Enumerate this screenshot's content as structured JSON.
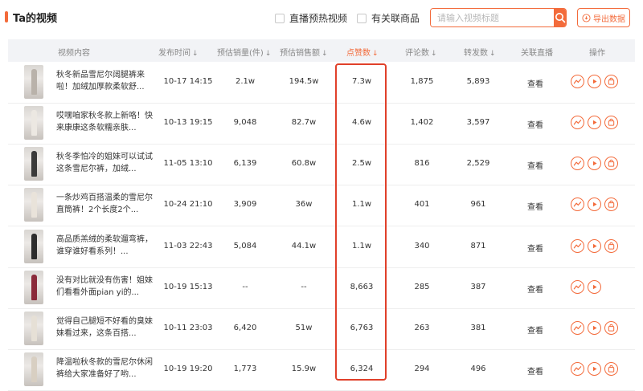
{
  "header": {
    "title": "Ta的视频",
    "checkbox_live_preheat": "直播预热视频",
    "checkbox_linked_product": "有关联商品",
    "search_placeholder": "请输入视频标题",
    "export_label": "导出数据"
  },
  "columns": {
    "content": "视频内容",
    "publish_time": "发布时间",
    "est_sales_qty": "预估销量(件)",
    "est_sales_amount": "预估销售额",
    "likes": "点赞数",
    "comments": "评论数",
    "shares": "转发数",
    "linked_live": "关联直播",
    "actions": "操作"
  },
  "sort_arrow": "↓",
  "view_label": "查看",
  "rows": [
    {
      "desc": "秋冬新品雪尼尔阔腿裤来啦！加绒加厚款柔软舒...",
      "time": "10-17 14:15",
      "qty": "2.1w",
      "amount": "194.5w",
      "likes": "7.3w",
      "comments": "1,875",
      "shares": "5,893",
      "thumb_color": "#b9b2aa",
      "has_product": true
    },
    {
      "desc": "哎嘿咱家秋冬款上新咯！快来康康这条软糯亲肤...",
      "time": "10-13 19:15",
      "qty": "9,048",
      "amount": "82.7w",
      "likes": "4.6w",
      "comments": "1,402",
      "shares": "3,597",
      "thumb_color": "#ece8e2",
      "has_product": true
    },
    {
      "desc": "秋冬季怕冷的姐妹可以试试这条雪尼尔裤，加绒...",
      "time": "11-05 13:10",
      "qty": "6,139",
      "amount": "60.8w",
      "likes": "2.5w",
      "comments": "816",
      "shares": "2,529",
      "thumb_color": "#3a3a3a",
      "has_product": true
    },
    {
      "desc": "一条炒鸡百搭温柔的雪尼尔直筒裤！2个长度2个...",
      "time": "10-24 21:10",
      "qty": "3,909",
      "amount": "36w",
      "likes": "1.1w",
      "comments": "401",
      "shares": "961",
      "thumb_color": "#e9e3da",
      "has_product": true
    },
    {
      "desc": "高品质羔绒的柔软遛弯裤，谁穿谁好看系列！...",
      "time": "11-03 22:43",
      "qty": "5,084",
      "amount": "44.1w",
      "likes": "1.1w",
      "comments": "340",
      "shares": "871",
      "thumb_color": "#2d2d2d",
      "has_product": true
    },
    {
      "desc": "没有对比就没有伤害！姐妹们看看外面pian yi的...",
      "time": "10-19 15:13",
      "qty": "--",
      "amount": "--",
      "likes": "8,663",
      "comments": "285",
      "shares": "387",
      "thumb_color": "#8a2a3a",
      "has_product": false
    },
    {
      "desc": "觉得自己腿短不好看的臭妹妹看过来，这条百搭...",
      "time": "10-11 23:03",
      "qty": "6,420",
      "amount": "51w",
      "likes": "6,763",
      "comments": "263",
      "shares": "381",
      "thumb_color": "#e6e0d6",
      "has_product": true
    },
    {
      "desc": "降温啦秋冬款的雪尼尔休闲裤给大家准备好了哟...",
      "time": "10-19 19:20",
      "qty": "1,773",
      "amount": "15.9w",
      "likes": "6,324",
      "comments": "294",
      "shares": "496",
      "thumb_color": "#d8cfc2",
      "has_product": true
    }
  ],
  "colors": {
    "accent": "#f36b3b",
    "highlight_border": "#e0402a"
  }
}
